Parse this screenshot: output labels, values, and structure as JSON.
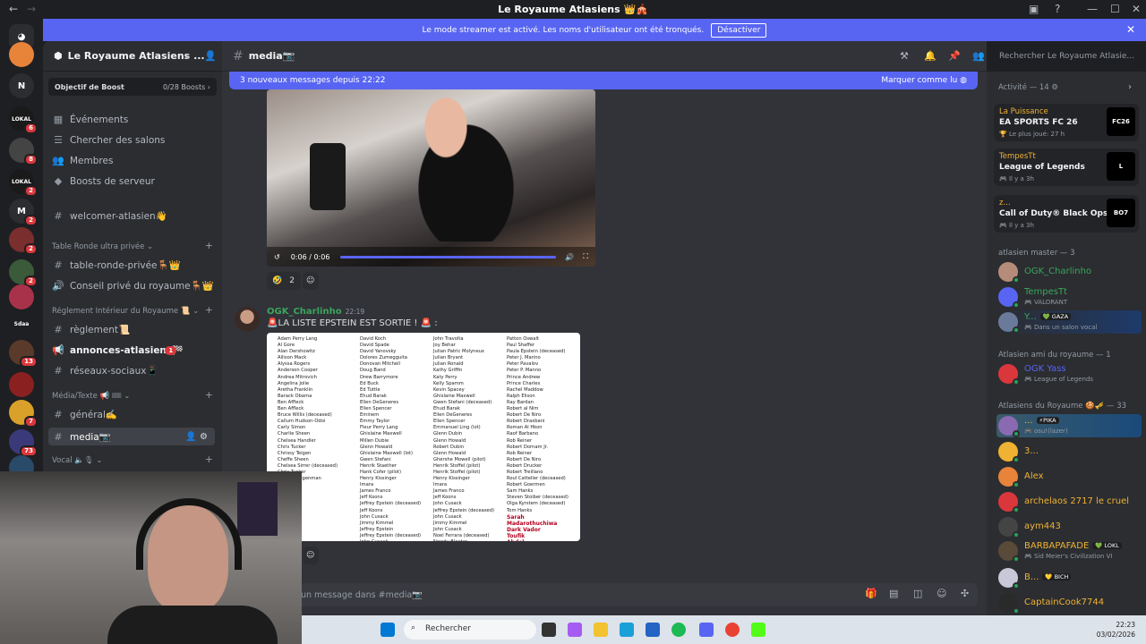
{
  "window": {
    "title": "Le Royaume Atlasiens 👑🎪"
  },
  "banner": {
    "text": "Le mode streamer est activé. Les noms d'utilisateur ont été tronqués.",
    "button": "Désactiver"
  },
  "servers": [
    {
      "label": "",
      "color": "#e8833a",
      "badge": ""
    },
    {
      "label": "N",
      "color": "#2b2d31",
      "badge": ""
    },
    {
      "label": "LOKAL",
      "color": "#1a1a1a",
      "badge": "6"
    },
    {
      "label": "",
      "color": "#444",
      "badge": "8"
    },
    {
      "label": "LOKAL",
      "color": "#1a1a1a",
      "badge": "2"
    },
    {
      "label": "M",
      "color": "#2b2d31",
      "badge": "2"
    },
    {
      "label": "",
      "color": "#7a2e2e",
      "badge": "2"
    },
    {
      "label": "",
      "color": "#3a5a3a",
      "badge": "2"
    },
    {
      "label": "",
      "color": "#a8324a",
      "badge": ""
    },
    {
      "label": "Sdaa",
      "color": "#1e1f22",
      "badge": ""
    },
    {
      "label": "",
      "color": "#5a3a2a",
      "badge": "13"
    },
    {
      "label": "",
      "color": "#8a2020",
      "badge": ""
    },
    {
      "label": "",
      "color": "#d9a02a",
      "badge": "7"
    },
    {
      "label": "",
      "color": "#3a3a7a",
      "badge": "73"
    },
    {
      "label": "",
      "color": "#2a4a6a",
      "badge": ""
    }
  ],
  "sidebar": {
    "server_name": "Le Royaume Atlasiens ...",
    "boost": {
      "label": "Objectif de Boost",
      "count": "0/28 Boosts"
    },
    "nav": [
      {
        "icon": "calendar-icon",
        "glyph": "▦",
        "label": "Événements"
      },
      {
        "icon": "browse-icon",
        "glyph": "☰",
        "label": "Chercher des salons"
      },
      {
        "icon": "members-icon",
        "glyph": "👥",
        "label": "Membres"
      },
      {
        "icon": "boost-icon",
        "glyph": "◆",
        "label": "Boosts de serveur"
      }
    ],
    "welcome": "welcomer-atlasien👋",
    "categories": [
      {
        "name": "Table Ronde ultra privée",
        "channels": [
          {
            "label": "table-ronde-privée🪑👑"
          },
          {
            "label": "Conseil privé du royaume🪑👑",
            "type": "voice"
          }
        ]
      },
      {
        "name": "Réglement Intérieur du Royaume 📜",
        "channels": [
          {
            "label": "règlement📜"
          },
          {
            "label": "annonces-atlasiens🏁",
            "mention": "1",
            "unread": true,
            "type": "announce"
          },
          {
            "label": "réseaux-sociaux📱"
          }
        ]
      },
      {
        "name": "Média/Texte 📢 🎟",
        "channels": [
          {
            "label": "général✍️"
          },
          {
            "label": "media📷",
            "active": true
          }
        ]
      },
      {
        "name": "Vocal 🔈🎙",
        "channels": [
          {
            "label": "Radio Atlasienne 👑",
            "type": "voice"
          }
        ]
      }
    ]
  },
  "header": {
    "channel": "media📷",
    "search_placeholder": "Rechercher Le Royaume Atlasie..."
  },
  "chat": {
    "new_messages": "3 nouveaux messages depuis 22:22",
    "mark_read": "Marquer comme lu",
    "video": {
      "time": "0:06 / 0:06",
      "progress": 1.0
    },
    "reaction": {
      "emoji": "🤣",
      "count": "2"
    },
    "message": {
      "author": "OGK_Charlinho",
      "time": "22:19",
      "text": "🚨LA LISTE EPSTEIN EST SORTIE ! 🚨 :",
      "document": {
        "columns": [
          [
            "Adam Perry Lang",
            "Al Gore",
            "Alan Dershowitz",
            "Allison Mack",
            "Alyssa Rogers",
            "Anderson Cooper",
            "Andrea Mitrovich",
            "Angelina Jolie",
            "Aretha Franklin",
            "Barack Obama",
            "Ben Affleck",
            "Ben Affleck",
            "Bruce Willis (deceased)",
            "Callum Hudson-Odoi",
            "Carly Simon",
            "Charlie Sheen",
            "Chelsea Handler",
            "Chris Tucker",
            "Chrissy Teigen",
            "Cheffe Sheen",
            "Chelsea Sirrer (deceased)",
            "Chris Tucker",
            "Chrissy Teigenman"
          ],
          [
            "David Koch",
            "David Spade",
            "David Yanovsky",
            "Dolores Zumegguita",
            "Donovan Mitchell",
            "Doug Band",
            "Drew Barrymore",
            "Ed Buck",
            "Ed Tuttle",
            "Ehud Barak",
            "Ellen DeGeneres",
            "Ellen Spencer",
            "Eminem",
            "Emmy Taylor",
            "Fleur Perry Lang",
            "Ghislaine Maxwell",
            "Millen Dubie",
            "Glenn Howald",
            "Ghislaine Maxwell (lot)",
            "Gwen Stefani",
            "Henrik Staether",
            "Hank Cofer (pilot)",
            "Henry Kissinger",
            "Imara",
            "James Franco",
            "Jeff Koons",
            "Jeffrey Epstein (deceased)",
            "Jeff Koons",
            "John Cusack",
            "Jimmy Kimmel",
            "Jeffrey Epstein",
            "Jeffrey Epstein (deceased)",
            "John Cusack",
            "Jimmy Kimmel",
            "Jimmy Franco",
            "Jeff Koons",
            "Jeffrey Epstein (deceased)"
          ],
          [
            "John Travolta",
            "Joy Behar",
            "Julian Patric Molyneux",
            "Julian Bryant",
            "Julian Ronald",
            "Kathy Griffin",
            "Katy Perry",
            "Kelly Spamm",
            "Kevin Spacey",
            "Ghislaine Maxwell",
            "Gwen Stefani (deceased)",
            "Ehud Barak",
            "Ellen DeGeneres",
            "Ellen Spencer",
            "Emmanuel Ling (lot)",
            "Glenn Dubin",
            "Glenn Howald",
            "Robert Dubin",
            "Glenn Howald",
            "Ghershe Mowell (pilot)",
            "Henrik Stoffel (pilot)",
            "Henrik Stoffel (pilot)",
            "Henry Kissinger",
            "Imara",
            "James Franco",
            "Jeff Koons",
            "John Cusack",
            "Jeffrey Epstein (deceased)",
            "John Cusack",
            "Jimmy Kimmel",
            "John Cusack",
            "Noel Ferrara (deceased)",
            "Nowdy Bloeter",
            "Tealle Davies"
          ],
          [
            "Patton Oswalt",
            "Paul Shaffer",
            "Paula Epstein (deceased)",
            "Peter J. Marino",
            "Peter Pavalov",
            "Peter P. Manno",
            "Prince Andrew",
            "Prince Charles",
            "Rachel Maddow",
            "Ralph Elison",
            "Ray Bardan",
            "Robert al Nim",
            "Robert De Niro",
            "Robert Draxbani",
            "Roman Al Hkon",
            "Raof Barbano",
            "Rob Reiner",
            "Robert Dornam Jr.",
            "Rob Reiner",
            "Robert De Niro",
            "Robert Drucker",
            "Robert Treillano",
            "Roul Catteller (deceased)",
            "Robert Goermen",
            "Sam Hanks",
            "Steven Stoiber (deceased)",
            "Olga Kyrstem (deceased)",
            "Tom Hanks"
          ]
        ],
        "highlight": [
          "Sarah",
          "Madarothuchiwa",
          "Dark Vador",
          "Toufik",
          "Abdel"
        ]
      }
    },
    "composer_placeholder": "un message dans #media📷"
  },
  "members": {
    "activity_header": "Activité — 14",
    "activities": [
      {
        "user": "La Puissance",
        "game": "EA SPORTS FC 26",
        "sub": "🏆 Le plus joué: 27 h",
        "logo": "FC26"
      },
      {
        "user": "TempesTt",
        "game": "League of Legends",
        "sub": "🎮 Il y a 3h",
        "logo": "L"
      },
      {
        "user": "z...",
        "game": "Call of Duty® Black Ops 7",
        "sub": "🎮 Il y a 3h",
        "logo": "BO7"
      }
    ],
    "sections": [
      {
        "title": "atlasien master — 3",
        "members": [
          {
            "name": "OGK_Charlinho",
            "color": "#3ba55d",
            "sub": "",
            "avatar": "#b58c7a"
          },
          {
            "name": "TempesTt",
            "color": "#3ba55d",
            "sub": "🎮 VALORANT",
            "avatar": "#5865f2"
          },
          {
            "name": "Y...",
            "color": "#3ba55d",
            "sub": "🎮 Dans un salon vocal",
            "avatar": "#6a7a9a",
            "tag": "💚 GAZA"
          }
        ]
      },
      {
        "title": "Atlasien ami du royaume — 1",
        "members": [
          {
            "name": "OGK Yass",
            "color": "#5865f2",
            "sub": "🎮 League of Legends",
            "avatar": "#da373c"
          }
        ]
      },
      {
        "title": "Atlasiens du Royaume 🍪🎺 — 33",
        "members": [
          {
            "name": "...",
            "color": "#f0b232",
            "sub": "🎮 osu!(lazer)",
            "avatar": "#8a6ab0",
            "tag": "⚡PIKA"
          },
          {
            "name": "3...",
            "color": "#f0b232",
            "sub": "",
            "avatar": "#f0b232"
          },
          {
            "name": "Alex",
            "color": "#f0b232",
            "sub": "",
            "avatar": "#e8833a"
          },
          {
            "name": "archelaos 2717 le cruel",
            "color": "#f0b232",
            "sub": "",
            "avatar": "#da373c"
          },
          {
            "name": "aym443",
            "color": "#f0b232",
            "sub": "",
            "avatar": "#444"
          },
          {
            "name": "BARBAPAFADE",
            "color": "#f0b232",
            "sub": "🎮 Sid Meier's Civilization VI",
            "avatar": "#5a4a3a",
            "tag": "💚 LOKL"
          },
          {
            "name": "B...",
            "color": "#f0b232",
            "sub": "",
            "avatar": "#c8c8d8",
            "tag": "💛 BICH"
          },
          {
            "name": "CaptainCook7744",
            "color": "#f0b232",
            "sub": "",
            "avatar": "#2a2a2a"
          }
        ]
      }
    ]
  },
  "taskbar": {
    "search": "Rechercher",
    "time": "22:23",
    "date": "03/02/2026"
  }
}
